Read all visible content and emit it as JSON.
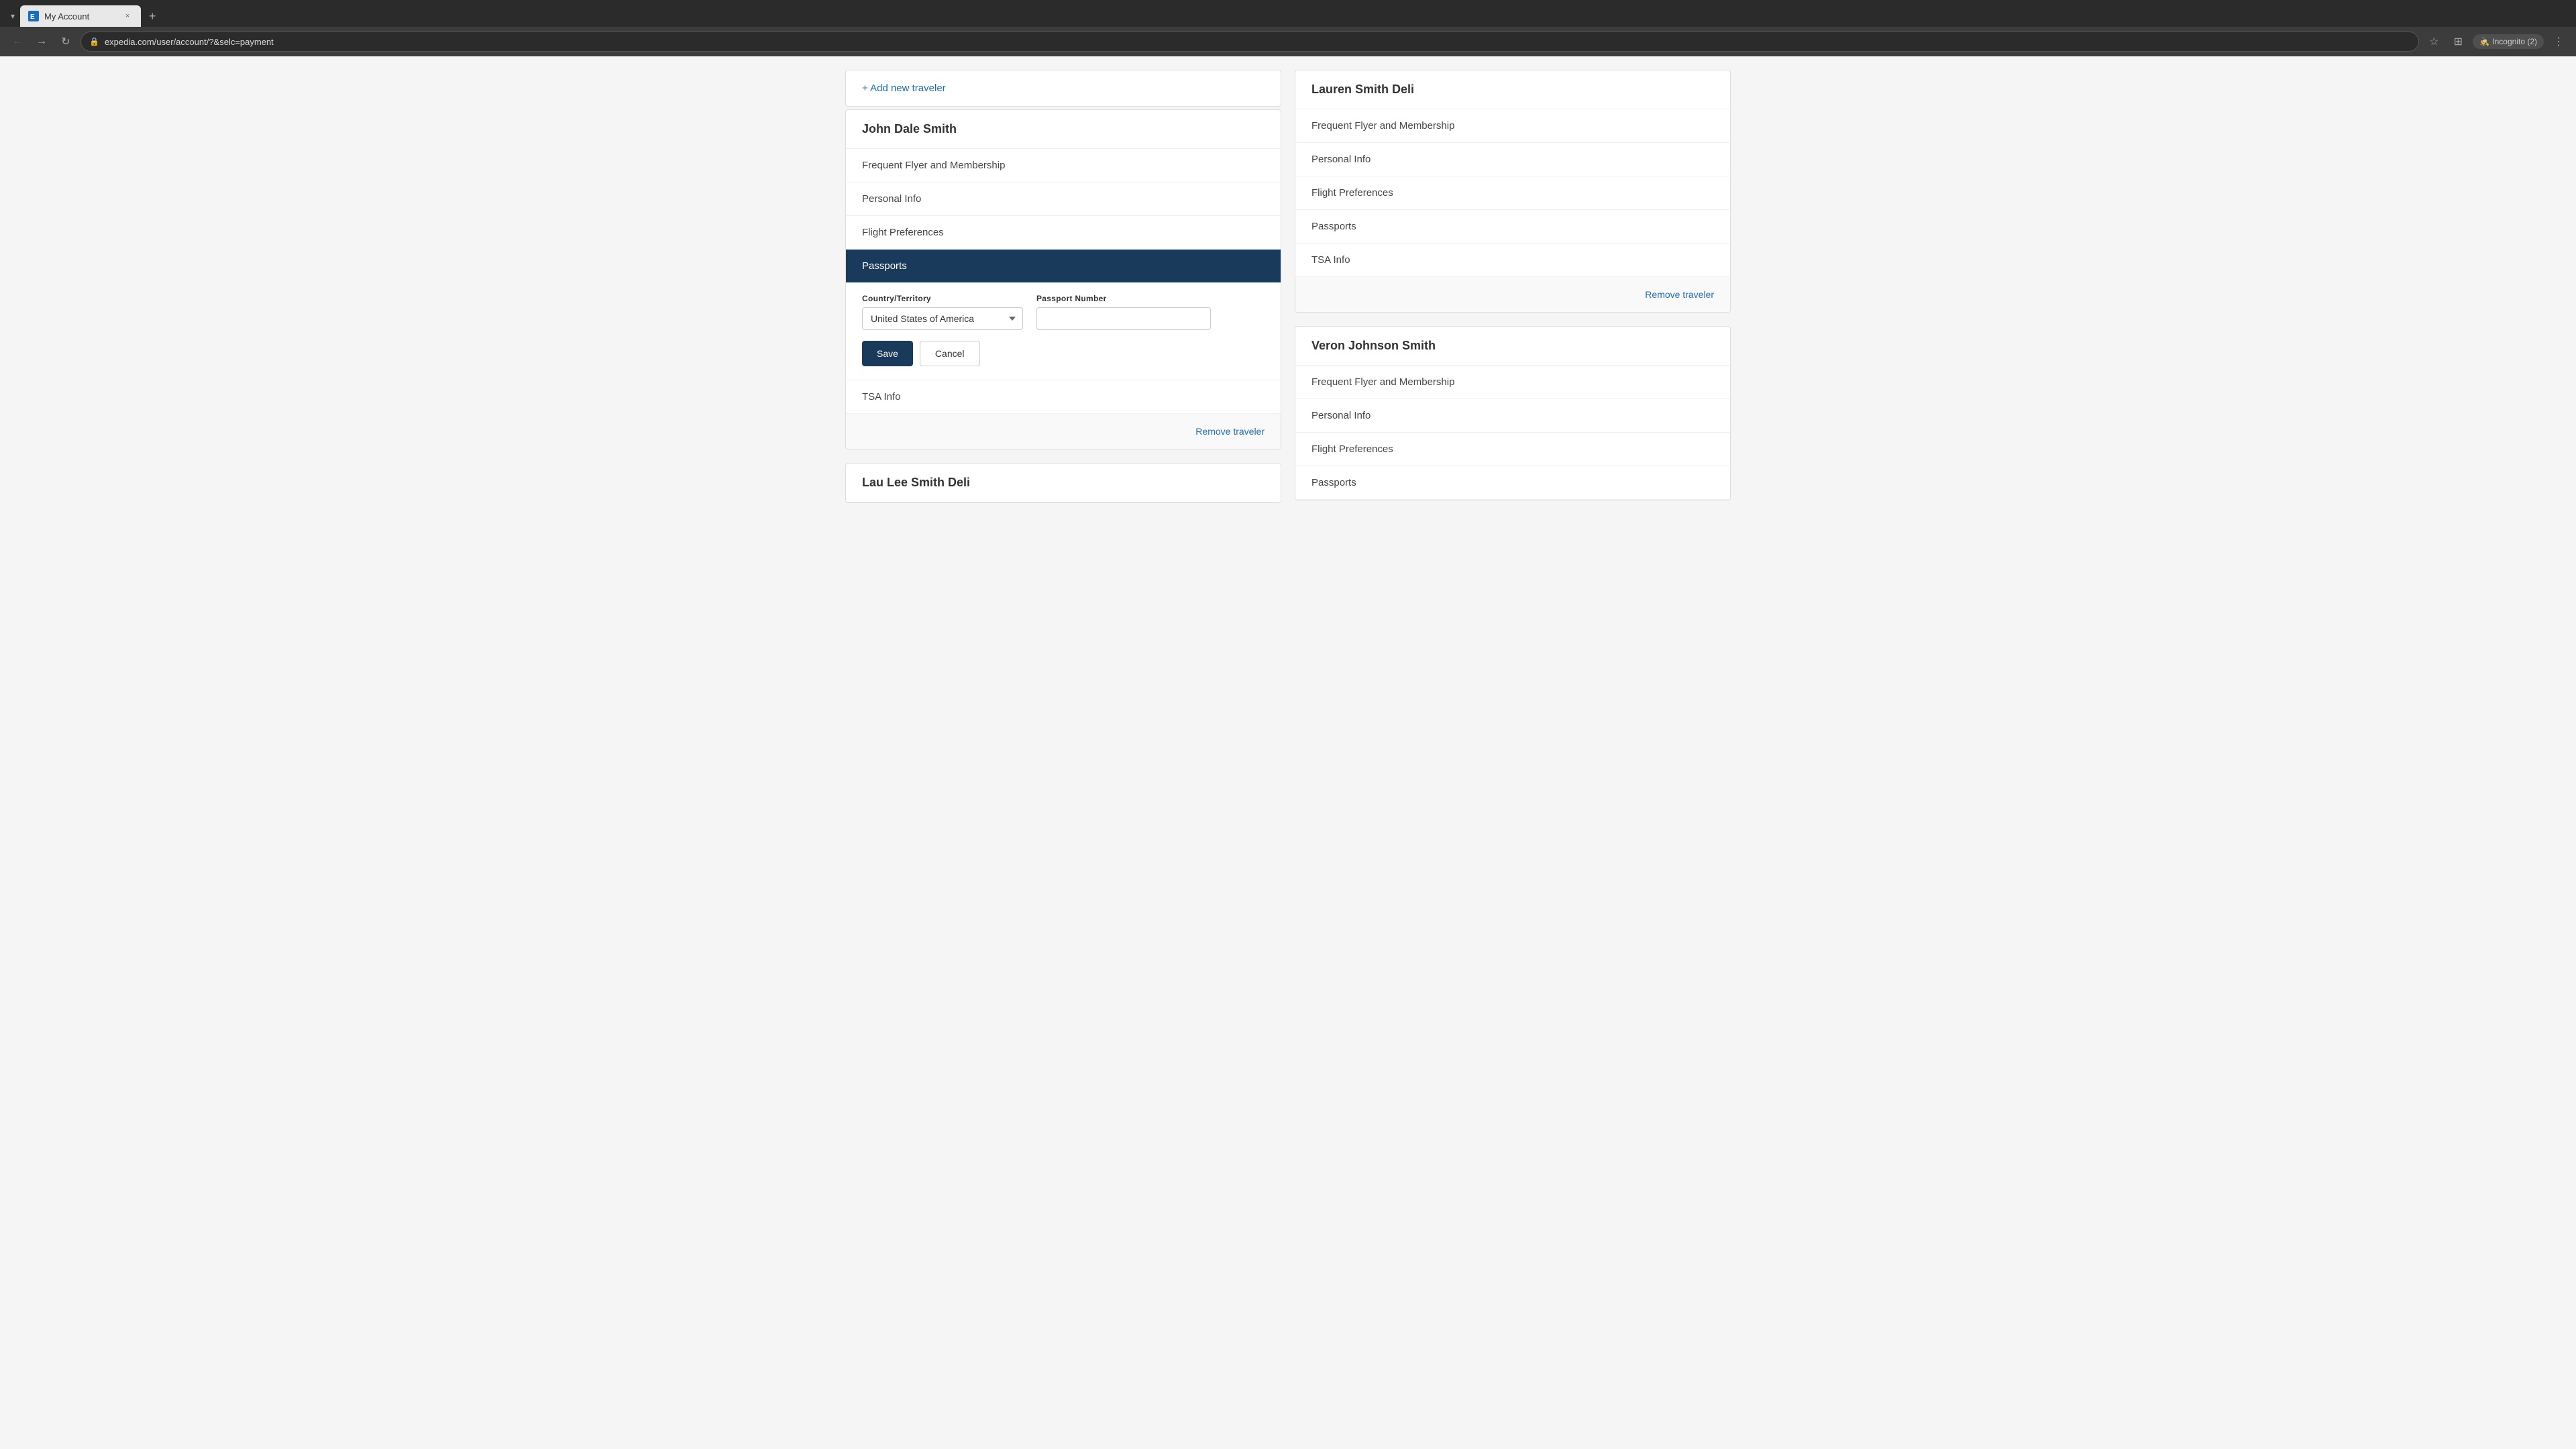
{
  "browser": {
    "tabs": [
      {
        "label": "My Account",
        "favicon": "E",
        "active": true,
        "close_btn": "×"
      }
    ],
    "new_tab_btn": "+",
    "tab_expand_btn": "▾",
    "url": "expedia.com/user/account/?&selc=payment",
    "back_btn": "←",
    "forward_btn": "→",
    "reload_btn": "↻",
    "bookmark_btn": "☆",
    "extensions_btn": "⊞",
    "incognito_label": "Incognito (2)",
    "menu_btn": "⋮"
  },
  "page": {
    "add_traveler_label": "+ Add new traveler",
    "travelers": [
      {
        "id": "john",
        "name": "John Dale Smith",
        "menu_items": [
          {
            "id": "frequent-flyer",
            "label": "Frequent Flyer and Membership",
            "active": false
          },
          {
            "id": "personal-info",
            "label": "Personal Info",
            "active": false
          },
          {
            "id": "flight-prefs",
            "label": "Flight Preferences",
            "active": false
          },
          {
            "id": "passports",
            "label": "Passports",
            "active": true
          }
        ],
        "passport_form": {
          "country_label": "Country/Territory",
          "country_value": "United States of America",
          "passport_label": "Passport Number",
          "passport_value": "",
          "save_btn": "Save",
          "cancel_btn": "Cancel"
        },
        "tsa_label": "TSA Info",
        "remove_link": "Remove traveler"
      },
      {
        "id": "lau-lee",
        "name": "Lau Lee Smith Deli",
        "menu_items": [],
        "passport_form": null,
        "tsa_label": null,
        "remove_link": null
      }
    ],
    "right_travelers": [
      {
        "id": "lauren",
        "name": "Lauren Smith Deli",
        "menu_items": [
          {
            "id": "frequent-flyer",
            "label": "Frequent Flyer and Membership",
            "active": false
          },
          {
            "id": "personal-info",
            "label": "Personal Info",
            "active": false
          },
          {
            "id": "flight-prefs",
            "label": "Flight Preferences",
            "active": false
          },
          {
            "id": "passports",
            "label": "Passports",
            "active": false
          },
          {
            "id": "tsa-info",
            "label": "TSA Info",
            "active": false
          }
        ],
        "remove_link": "Remove traveler"
      },
      {
        "id": "veron",
        "name": "Veron Johnson Smith",
        "menu_items": [
          {
            "id": "frequent-flyer",
            "label": "Frequent Flyer and Membership",
            "active": false
          },
          {
            "id": "personal-info",
            "label": "Personal Info",
            "active": false
          },
          {
            "id": "flight-prefs",
            "label": "Flight Preferences",
            "active": false
          },
          {
            "id": "passports-partial",
            "label": "Passports",
            "active": false
          }
        ]
      }
    ]
  }
}
